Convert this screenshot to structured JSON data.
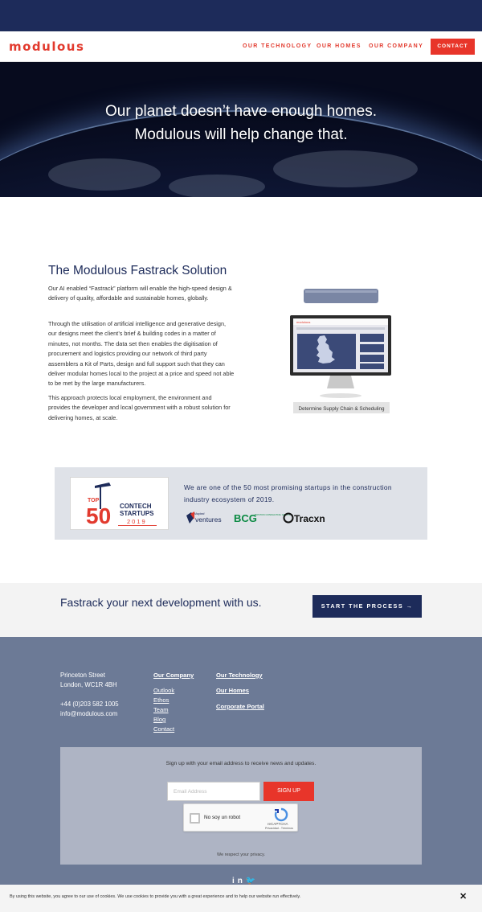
{
  "brand": {
    "logo_text": "modulous",
    "accent": "#e23a2e",
    "navy": "#1d2b5a"
  },
  "nav": {
    "items": [
      {
        "label": "OUR TECHNOLOGY"
      },
      {
        "label": "OUR HOMES"
      },
      {
        "label": "OUR COMPANY"
      }
    ],
    "contact_label": "CONTACT"
  },
  "hero": {
    "line1": "Our planet doesn’t have enough homes.",
    "line2": "Modulous will help change that."
  },
  "fastrack": {
    "title": "The Modulous Fastrack Solution",
    "p1": "Our AI enabled “Fastrack” platform will enable the high-speed design & delivery of quality, affordable and sustainable homes, globally.",
    "p2": "Through the utilisation of artificial intelligence and generative design, our designs meet the client’s brief & building codes in a matter of minutes, not months. The data set then enables the digitisation of procurement and logistics providing our network of third party assemblers a Kit of Parts, design and full support such that they can deliver modular homes local to the project at a price and speed not able to be met by the large manufacturers.",
    "p3": "This approach protects local employment, the environment and provides the developer and local government with a robust solution for delivering homes, at scale.",
    "illustration_caption": "Determine Supply Chain & Scheduling",
    "screen_brand": "modulous"
  },
  "startups": {
    "badge_top": "TOP",
    "badge_number": "50",
    "badge_line1": "CONTECH",
    "badge_line2": "STARTUPS",
    "badge_year": "2019",
    "text": "We are one of the 50 most promising startups in the construction industry ecosystem of 2019.",
    "partner1_top": "Mapleaf",
    "partner1": "ventures",
    "partner2": "BCG",
    "partner2_sub": "BOSTON CONSULTING GROUP",
    "partner3": "Tracxn"
  },
  "cta": {
    "text": "Fastrack your next development with us.",
    "button": "START THE PROCESS →"
  },
  "footer": {
    "address1": "Princeton Street",
    "address2": "London, WC1R 4BH",
    "phone": "+44 (0)203 582 1005",
    "email": "info@modulous.com",
    "col1_head": "Our Company",
    "col1_links": [
      "Outlook",
      "Ethos",
      "Team",
      "Blog",
      "Contact"
    ],
    "col2_links": [
      "Our Technology",
      "Our Homes",
      "Corporate Portal"
    ],
    "signup_text": "Sign up with your email address to receive news and updates.",
    "email_placeholder": "Email Address",
    "signup_button": "SIGN UP",
    "captcha_label": "No soy un robot",
    "captcha_brand": "reCAPTCHA",
    "captcha_small": "Privacidad - Términos",
    "privacy": "We respect your privacy.",
    "social": "in 🐦"
  },
  "cookie": {
    "text": "By using this website, you agree to our use of cookies. We use cookies to provide you with a great experience and to help our website run effectively.",
    "close": "✕"
  }
}
